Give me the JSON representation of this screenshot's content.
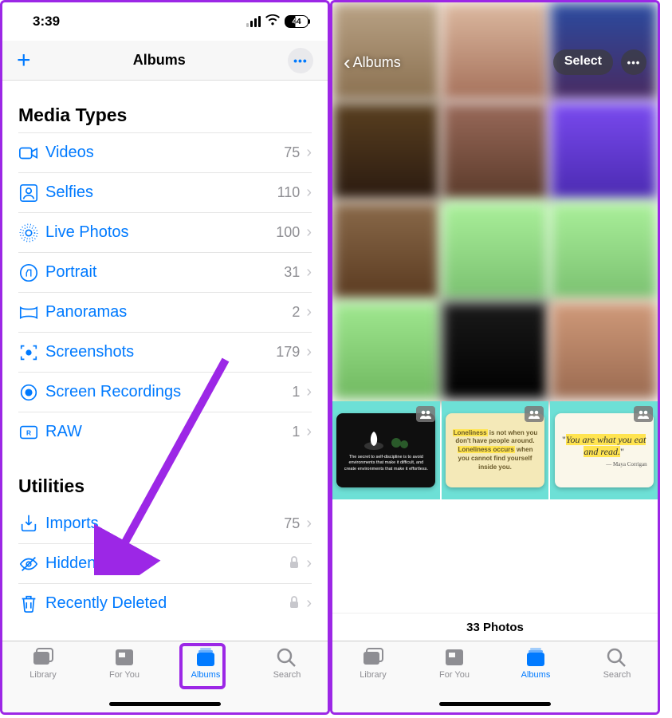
{
  "left": {
    "status": {
      "time": "3:39",
      "battery": "44"
    },
    "nav": {
      "title": "Albums"
    },
    "sections": [
      {
        "header": "Media Types",
        "rows": [
          {
            "icon": "video",
            "label": "Videos",
            "count": "75"
          },
          {
            "icon": "selfie",
            "label": "Selfies",
            "count": "110"
          },
          {
            "icon": "live",
            "label": "Live Photos",
            "count": "100"
          },
          {
            "icon": "portrait",
            "label": "Portrait",
            "count": "31"
          },
          {
            "icon": "panorama",
            "label": "Panoramas",
            "count": "2"
          },
          {
            "icon": "screenshot",
            "label": "Screenshots",
            "count": "179"
          },
          {
            "icon": "recording",
            "label": "Screen Recordings",
            "count": "1"
          },
          {
            "icon": "raw",
            "label": "RAW",
            "count": "1"
          }
        ]
      },
      {
        "header": "Utilities",
        "rows": [
          {
            "icon": "imports",
            "label": "Imports",
            "count": "75"
          },
          {
            "icon": "hidden",
            "label": "Hidden",
            "lock": true
          },
          {
            "icon": "trash",
            "label": "Recently Deleted",
            "lock": true
          }
        ]
      }
    ],
    "tabs": [
      {
        "id": "library",
        "label": "Library"
      },
      {
        "id": "foryou",
        "label": "For You"
      },
      {
        "id": "albums",
        "label": "Albums",
        "active": true
      },
      {
        "id": "search",
        "label": "Search"
      }
    ]
  },
  "right": {
    "header": {
      "back": "Albums",
      "select": "Select"
    },
    "cards": {
      "black_text": "The secret to self-discipline is to avoid environments that make it difficult, and create environments that make it effortless.",
      "yellow_text": "Loneliness is not when you don't have people around. Loneliness occurs when you cannot find yourself inside you.",
      "cream_quote": "“You are what you eat and read.”",
      "cream_author": "— Maya Corrigan"
    },
    "footer": "33 Photos",
    "tabs": [
      {
        "id": "library",
        "label": "Library"
      },
      {
        "id": "foryou",
        "label": "For You"
      },
      {
        "id": "albums",
        "label": "Albums",
        "active": true
      },
      {
        "id": "search",
        "label": "Search"
      }
    ]
  }
}
